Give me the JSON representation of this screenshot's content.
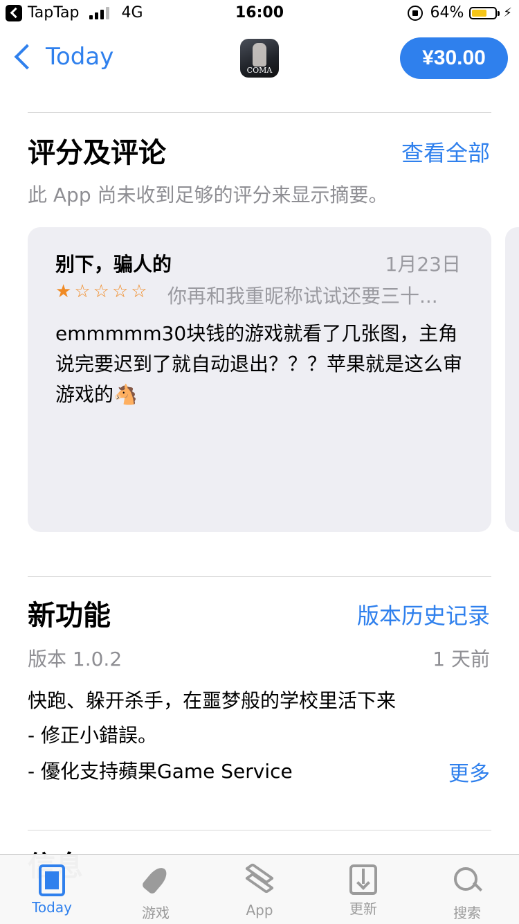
{
  "status_bar": {
    "carrier": "TapTap",
    "network": "4G",
    "time": "16:00",
    "battery": "64%"
  },
  "nav": {
    "back_label": "Today",
    "app_icon_text": "COMA",
    "price": "¥30.00"
  },
  "ratings": {
    "title": "评分及评论",
    "see_all": "查看全部",
    "summary_note": "此 App 尚未收到足够的评分来显示摘要。",
    "review": {
      "title": "别下，骗人的",
      "date": "1月23日",
      "stars": 1,
      "author": "你再和我重昵称试试还要三十...",
      "body": "emmmmm30块钱的游戏就看了几张图，主角说完要迟到了就自动退出？？？苹果就是这么审游戏的🐴"
    }
  },
  "whats_new": {
    "title": "新功能",
    "version_history": "版本历史记录",
    "version": "版本 1.0.2",
    "age": "1 天前",
    "line1": "快跑、躲开杀手，在噩梦般的学校里活下来",
    "line2": "- 修正小錯誤。",
    "line3": "- 優化支持蘋果Game Service",
    "more": "更多"
  },
  "next_section_title": "信息",
  "tabbar": {
    "tabs": [
      {
        "label": "Today",
        "icon": "today-icon"
      },
      {
        "label": "游戏",
        "icon": "rocket-icon"
      },
      {
        "label": "App",
        "icon": "layers-icon"
      },
      {
        "label": "更新",
        "icon": "download-icon"
      },
      {
        "label": "搜索",
        "icon": "search-icon"
      }
    ],
    "active_index": 0
  },
  "colors": {
    "accent": "#2f80ed",
    "star": "#f08a24",
    "card_bg": "#eeeef3",
    "battery_fill": "#f5c518"
  }
}
